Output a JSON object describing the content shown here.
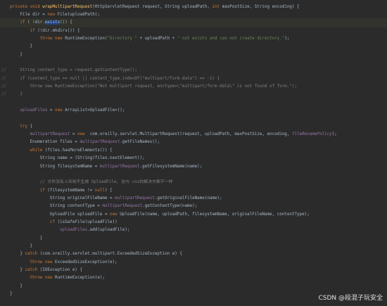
{
  "editor": {
    "lines": [
      {
        "g": "",
        "hl": false,
        "t": [
          {
            "c": "kw",
            "v": "    private void "
          },
          {
            "c": "fn",
            "v": "wrapMultipartRequest"
          },
          {
            "c": "",
            "v": "(HttpServletRequest request, String uploadPath, "
          },
          {
            "c": "kw",
            "v": "int "
          },
          {
            "c": "",
            "v": "maxPostSize, String encoding) {"
          }
        ]
      },
      {
        "g": "",
        "hl": false,
        "t": [
          {
            "c": "",
            "v": "        File dir = "
          },
          {
            "c": "kw",
            "v": "new "
          },
          {
            "c": "",
            "v": "File(uploadPath);"
          }
        ]
      },
      {
        "g": "",
        "hl": true,
        "t": [
          {
            "c": "kw",
            "v": "        if "
          },
          {
            "c": "",
            "v": "( !dir."
          },
          {
            "c": "sel",
            "v": "exists"
          },
          {
            "c": "",
            "v": "()) {"
          }
        ]
      },
      {
        "g": "",
        "hl": false,
        "t": [
          {
            "c": "kw",
            "v": "            if "
          },
          {
            "c": "",
            "v": "(!dir.mkdirs()) {"
          }
        ]
      },
      {
        "g": "",
        "hl": false,
        "t": [
          {
            "c": "kw",
            "v": "                throw new "
          },
          {
            "c": "",
            "v": "RuntimeException("
          },
          {
            "c": "str",
            "v": "\"Directory \""
          },
          {
            "c": "",
            "v": " + uploadPath + "
          },
          {
            "c": "str",
            "v": "\" not exists and can not create directory.\""
          },
          {
            "c": "",
            "v": ");"
          }
        ]
      },
      {
        "g": "",
        "hl": false,
        "t": [
          {
            "c": "",
            "v": "            }"
          }
        ]
      },
      {
        "g": "",
        "hl": false,
        "t": [
          {
            "c": "",
            "v": "        }"
          }
        ]
      },
      {
        "g": "",
        "hl": false,
        "t": []
      },
      {
        "g": "//",
        "hl": false,
        "t": [
          {
            "c": "cm",
            "v": "        String content_type = request.getContentType();"
          }
        ]
      },
      {
        "g": "//",
        "hl": false,
        "t": [
          {
            "c": "cm",
            "v": "        if (content_type == null || content_type.indexOf(\"multipart/form-data\") == -1) {"
          }
        ]
      },
      {
        "g": "//",
        "hl": false,
        "t": [
          {
            "c": "cm",
            "v": "            throw new RuntimeException(\"Not multipart request, enctype=\\\"multipart/form-data\\\" is not found of form.\");"
          }
        ]
      },
      {
        "g": "//",
        "hl": false,
        "t": [
          {
            "c": "cm",
            "v": "        }"
          }
        ]
      },
      {
        "g": "",
        "hl": false,
        "t": []
      },
      {
        "g": "",
        "hl": false,
        "t": [
          {
            "c": "fld",
            "v": "        uploadFiles"
          },
          {
            "c": "",
            "v": " = "
          },
          {
            "c": "kw",
            "v": "new "
          },
          {
            "c": "",
            "v": "ArrayList<UploadFile>();"
          }
        ]
      },
      {
        "g": "",
        "hl": false,
        "t": []
      },
      {
        "g": "",
        "hl": false,
        "t": [
          {
            "c": "kw",
            "v": "        try "
          },
          {
            "c": "",
            "v": "{"
          }
        ]
      },
      {
        "g": "",
        "hl": false,
        "t": [
          {
            "c": "fld",
            "v": "            multipartRequest"
          },
          {
            "c": "",
            "v": " = "
          },
          {
            "c": "kw",
            "v": "new  "
          },
          {
            "c": "",
            "v": "com.oreilly.servlet.MultipartRequest(request, uploadPath, maxPostSize, encoding, "
          },
          {
            "c": "fld it",
            "v": "fileRenamePolicy"
          },
          {
            "c": "",
            "v": ");"
          }
        ]
      },
      {
        "g": "",
        "hl": false,
        "t": [
          {
            "c": "",
            "v": "            Enumeration files = "
          },
          {
            "c": "fld",
            "v": "multipartRequest"
          },
          {
            "c": "",
            "v": ".getFileNames();"
          }
        ]
      },
      {
        "g": "",
        "hl": false,
        "t": [
          {
            "c": "kw",
            "v": "            while "
          },
          {
            "c": "",
            "v": "(files.hasMoreElements()) {"
          }
        ]
      },
      {
        "g": "",
        "hl": false,
        "t": [
          {
            "c": "",
            "v": "                String name = (String)files.nextElement();"
          }
        ]
      },
      {
        "g": "",
        "hl": false,
        "t": [
          {
            "c": "",
            "v": "                String filesystemName = "
          },
          {
            "c": "fld",
            "v": "multipartRequest"
          },
          {
            "c": "",
            "v": ".getFilesystemName(name);"
          }
        ]
      },
      {
        "g": "",
        "hl": false,
        "t": []
      },
      {
        "g": "",
        "hl": false,
        "t": [
          {
            "c": "cm",
            "v": "                // 文件没有上传则不生成 UploadFile, 这与 cos的解决方案不一样"
          }
        ]
      },
      {
        "g": "",
        "hl": false,
        "t": [
          {
            "c": "kw",
            "v": "                if "
          },
          {
            "c": "",
            "v": "(filesystemName != "
          },
          {
            "c": "kw",
            "v": "null"
          },
          {
            "c": "",
            "v": ") {"
          }
        ]
      },
      {
        "g": "",
        "hl": false,
        "t": [
          {
            "c": "",
            "v": "                    String originalFileName = "
          },
          {
            "c": "fld",
            "v": "multipartRequest"
          },
          {
            "c": "",
            "v": ".getOriginalFileName(name);"
          }
        ]
      },
      {
        "g": "",
        "hl": false,
        "t": [
          {
            "c": "",
            "v": "                    String contentType = "
          },
          {
            "c": "fld",
            "v": "multipartRequest"
          },
          {
            "c": "",
            "v": ".getContentType(name);"
          }
        ]
      },
      {
        "g": "",
        "hl": false,
        "t": [
          {
            "c": "",
            "v": "                    UploadFile uploadFile = "
          },
          {
            "c": "kw",
            "v": "new "
          },
          {
            "c": "",
            "v": "UploadFile(name, uploadPath, filesystemName, originalFileName, contentType);"
          }
        ]
      },
      {
        "g": "",
        "hl": false,
        "t": [
          {
            "c": "kw",
            "v": "                    if "
          },
          {
            "c": "",
            "v": "(isSafeFile(uploadFile))"
          }
        ]
      },
      {
        "g": "",
        "hl": false,
        "t": [
          {
            "c": "fld",
            "v": "                        uploadFiles"
          },
          {
            "c": "",
            "v": ".add(uploadFile);"
          }
        ]
      },
      {
        "g": "",
        "hl": false,
        "t": [
          {
            "c": "",
            "v": "                }"
          }
        ]
      },
      {
        "g": "",
        "hl": false,
        "t": [
          {
            "c": "",
            "v": "            }"
          }
        ]
      },
      {
        "g": "",
        "hl": false,
        "t": [
          {
            "c": "",
            "v": "        } "
          },
          {
            "c": "kw",
            "v": "catch "
          },
          {
            "c": "",
            "v": "(com.oreilly.servlet.multipart.ExceededSizeException e) {"
          }
        ]
      },
      {
        "g": "",
        "hl": false,
        "t": [
          {
            "c": "kw",
            "v": "            throw new "
          },
          {
            "c": "",
            "v": "ExceededSizeException(e);"
          }
        ]
      },
      {
        "g": "",
        "hl": false,
        "t": [
          {
            "c": "",
            "v": "        } "
          },
          {
            "c": "kw",
            "v": "catch "
          },
          {
            "c": "",
            "v": "(IOException e) {"
          }
        ]
      },
      {
        "g": "",
        "hl": false,
        "t": [
          {
            "c": "kw",
            "v": "            throw new "
          },
          {
            "c": "",
            "v": "RuntimeException(e);"
          }
        ]
      },
      {
        "g": "",
        "hl": false,
        "t": [
          {
            "c": "",
            "v": "        }"
          }
        ]
      },
      {
        "g": "",
        "hl": false,
        "t": [
          {
            "c": "",
            "v": "    }"
          }
        ]
      }
    ]
  },
  "watermark": "CSDN @段混子玩安全"
}
